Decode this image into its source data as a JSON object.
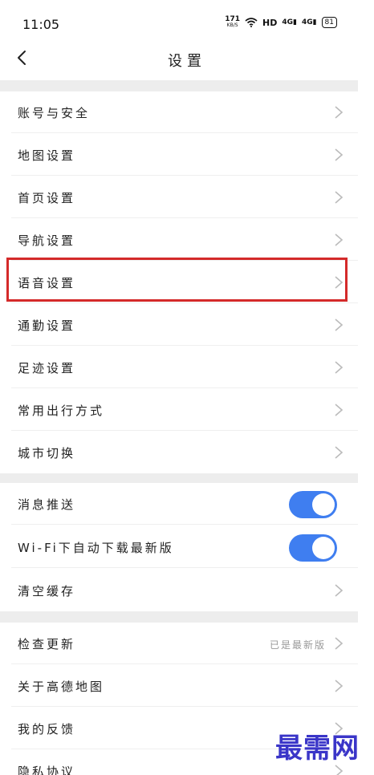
{
  "status_bar": {
    "time": "11:05",
    "speed_value": "171",
    "speed_unit": "KB/S",
    "hd": "HD",
    "signal1": "4G",
    "signal2": "4G",
    "battery": "81"
  },
  "header": {
    "back_icon": "chevron-left-icon",
    "title": "设置"
  },
  "group1": [
    {
      "label": "账号与安全"
    },
    {
      "label": "地图设置"
    },
    {
      "label": "首页设置"
    },
    {
      "label": "导航设置"
    },
    {
      "label": "语音设置"
    },
    {
      "label": "通勤设置"
    },
    {
      "label": "足迹设置"
    },
    {
      "label": "常用出行方式"
    },
    {
      "label": "城市切换"
    }
  ],
  "group2": [
    {
      "label": "消息推送",
      "toggle": true
    },
    {
      "label": "Wi-Fi下自动下载最新版",
      "toggle": true
    },
    {
      "label": "清空缓存"
    }
  ],
  "group3": [
    {
      "label": "检查更新",
      "value": "已是最新版"
    },
    {
      "label": "关于高德地图"
    },
    {
      "label": "我的反馈"
    },
    {
      "label": "隐私协议"
    }
  ],
  "colors": {
    "accent": "#3f7ef0",
    "highlight": "#d42a2a",
    "watermark": "#3a35c8"
  },
  "watermark": "最需网"
}
